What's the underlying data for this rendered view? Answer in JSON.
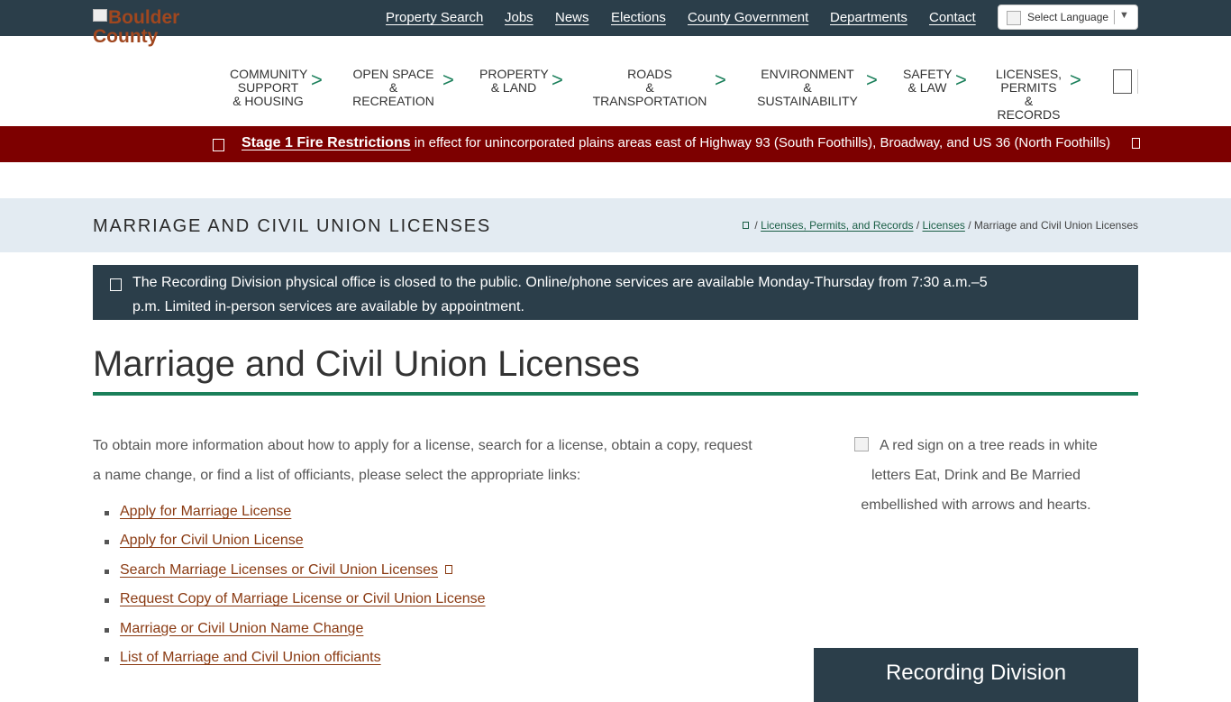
{
  "logo": {
    "text": "Boulder County"
  },
  "top_links": [
    "Property Search",
    "Jobs",
    "News",
    "Elections",
    "County Government",
    "Departments",
    "Contact"
  ],
  "translate": {
    "label": "Select Language",
    "arrow": "▼"
  },
  "main_nav": [
    {
      "line1": "Community",
      "line2": "Support",
      "line3": "& Housing",
      "chev": ">"
    },
    {
      "line1": "Open Space",
      "line2": "& Recreation",
      "line3": "",
      "chev": ">"
    },
    {
      "line1": "Property",
      "line2": "& Land",
      "line3": "",
      "chev": ">"
    },
    {
      "line1": "Roads",
      "line2": "& Transportation",
      "line3": "",
      "chev": ">"
    },
    {
      "line1": "Environment",
      "line2": "& Sustainability",
      "line3": "",
      "chev": ">"
    },
    {
      "line1": "Safety",
      "line2": "& Law",
      "line3": "",
      "chev": ">"
    },
    {
      "line1": "Licenses,",
      "line2": "Permits",
      "line3": "& Records",
      "chev": ">"
    }
  ],
  "alert": {
    "link": "Stage 1 Fire Restrictions",
    "text": " in effect for unincorporated plains areas east of Highway 93 (South Foothills), Broadway, and US 36 (North Foothills)"
  },
  "page_header": {
    "title": "Marriage and Civil Union Licenses",
    "breadcrumb": {
      "sep1": " / ",
      "crumb1": "Licenses, Permits, and Records",
      "sep2": " / ",
      "crumb2": "Licenses",
      "sep3": " / ",
      "current": "Marriage and Civil Union Licenses"
    }
  },
  "notice": {
    "text": "The Recording Division physical office is closed to the public. Online/phone services are available Monday-Thursday from 7:30 a.m.–5 p.m. Limited in-person services are available by appointment."
  },
  "heading": "Marriage and Civil Union Licenses",
  "intro": "To obtain more information about how to apply for a license, search for a license, obtain a copy, request a name change, or find a list of officiants, please select the appropriate links:",
  "links": [
    "Apply for Marriage License",
    "Apply for Civil Union License",
    "Search Marriage Licenses or Civil Union Licenses",
    "Request Copy of Marriage License or Civil Union License",
    "Marriage or Civil Union Name Change",
    "List of Marriage and Civil Union officiants"
  ],
  "side_image_alt": "A red sign on a tree reads in white letters Eat, Drink and Be Married embellished with arrows and hearts.",
  "side_box": {
    "title": "Recording Division"
  },
  "colors": {
    "top_bar": "#2b3e4a",
    "accent_green": "#1a7f5a",
    "alert_red": "#7d0000",
    "band": "#e3ebf2",
    "link_brown": "#8a3a12"
  }
}
